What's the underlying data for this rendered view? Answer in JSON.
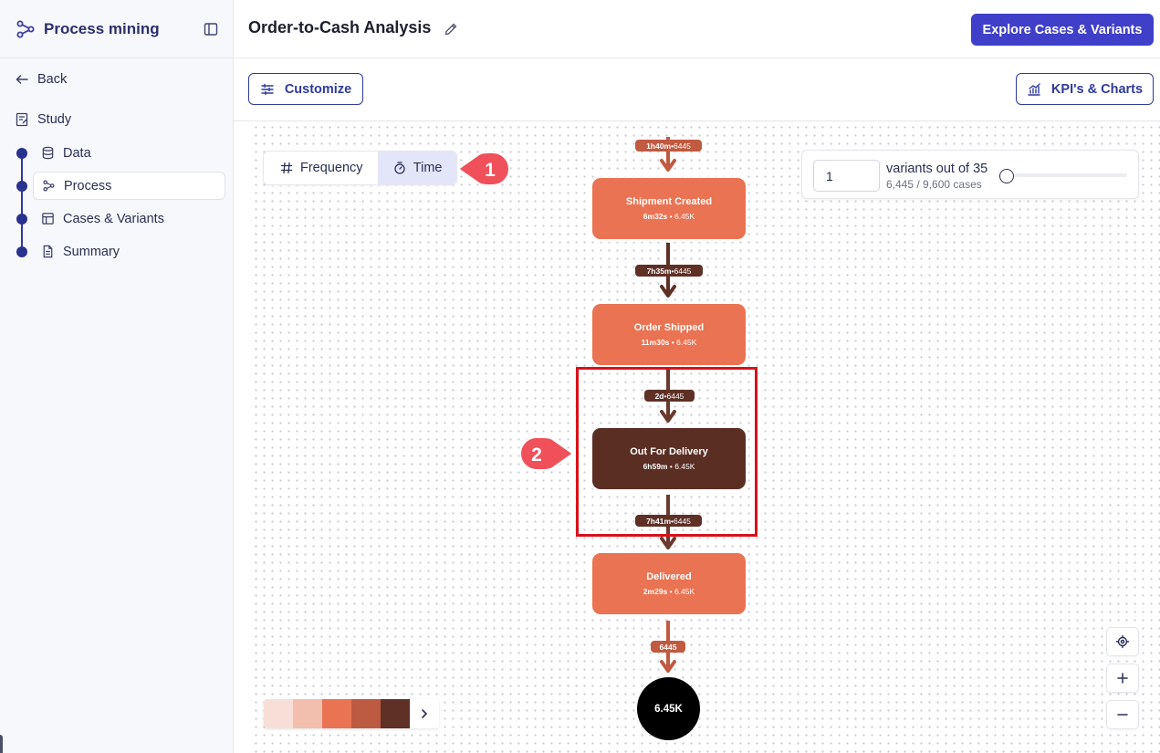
{
  "sidebar": {
    "app_title": "Process mining",
    "back_label": "Back",
    "study_label": "Study",
    "items": [
      {
        "label": "Data"
      },
      {
        "label": "Process"
      },
      {
        "label": "Cases & Variants"
      },
      {
        "label": "Summary"
      }
    ],
    "active_item": "Process"
  },
  "header": {
    "title": "Order-to-Cash Analysis",
    "primary_button": "Explore Cases & Variants"
  },
  "toolbar": {
    "customize_label": "Customize",
    "kpi_label": "KPI's & Charts"
  },
  "view_toggle": {
    "frequency_label": "Frequency",
    "time_label": "Time",
    "selected": "Time"
  },
  "annotations": {
    "badge_1": "1",
    "badge_2": "2"
  },
  "variants": {
    "input_value": "1",
    "label": "variants out of 35",
    "sub": "6,445 / 9,600 cases",
    "slider_position": 0
  },
  "process_map": {
    "edges": [
      {
        "duration": "1h40m",
        "count": "6445"
      },
      {
        "duration": "7h35m",
        "count": "6445"
      },
      {
        "duration": "2d",
        "count": "6445"
      },
      {
        "duration": "7h41m",
        "count": "6445"
      },
      {
        "duration": "",
        "count": "6445"
      }
    ],
    "nodes": [
      {
        "title": "Shipment Created",
        "duration": "6m32s",
        "count": "6.45K"
      },
      {
        "title": "Order Shipped",
        "duration": "11m30s",
        "count": "6.45K"
      },
      {
        "title": "Out For Delivery",
        "duration": "6h59m",
        "count": "6.45K"
      },
      {
        "title": "Delivered",
        "duration": "2m29s",
        "count": "6.45K"
      }
    ],
    "end_node": "6.45K",
    "separator": " • "
  },
  "legend": {
    "colors": [
      "#f7dfd8",
      "#f2bfae",
      "#e97352",
      "#bd5a42",
      "#5e3026"
    ]
  },
  "colors": {
    "primary": "#3f3fc9",
    "node_light": "#e97352",
    "node_dark": "#5b2e24",
    "highlight": "#d8111a",
    "badge": "#f0505a"
  }
}
